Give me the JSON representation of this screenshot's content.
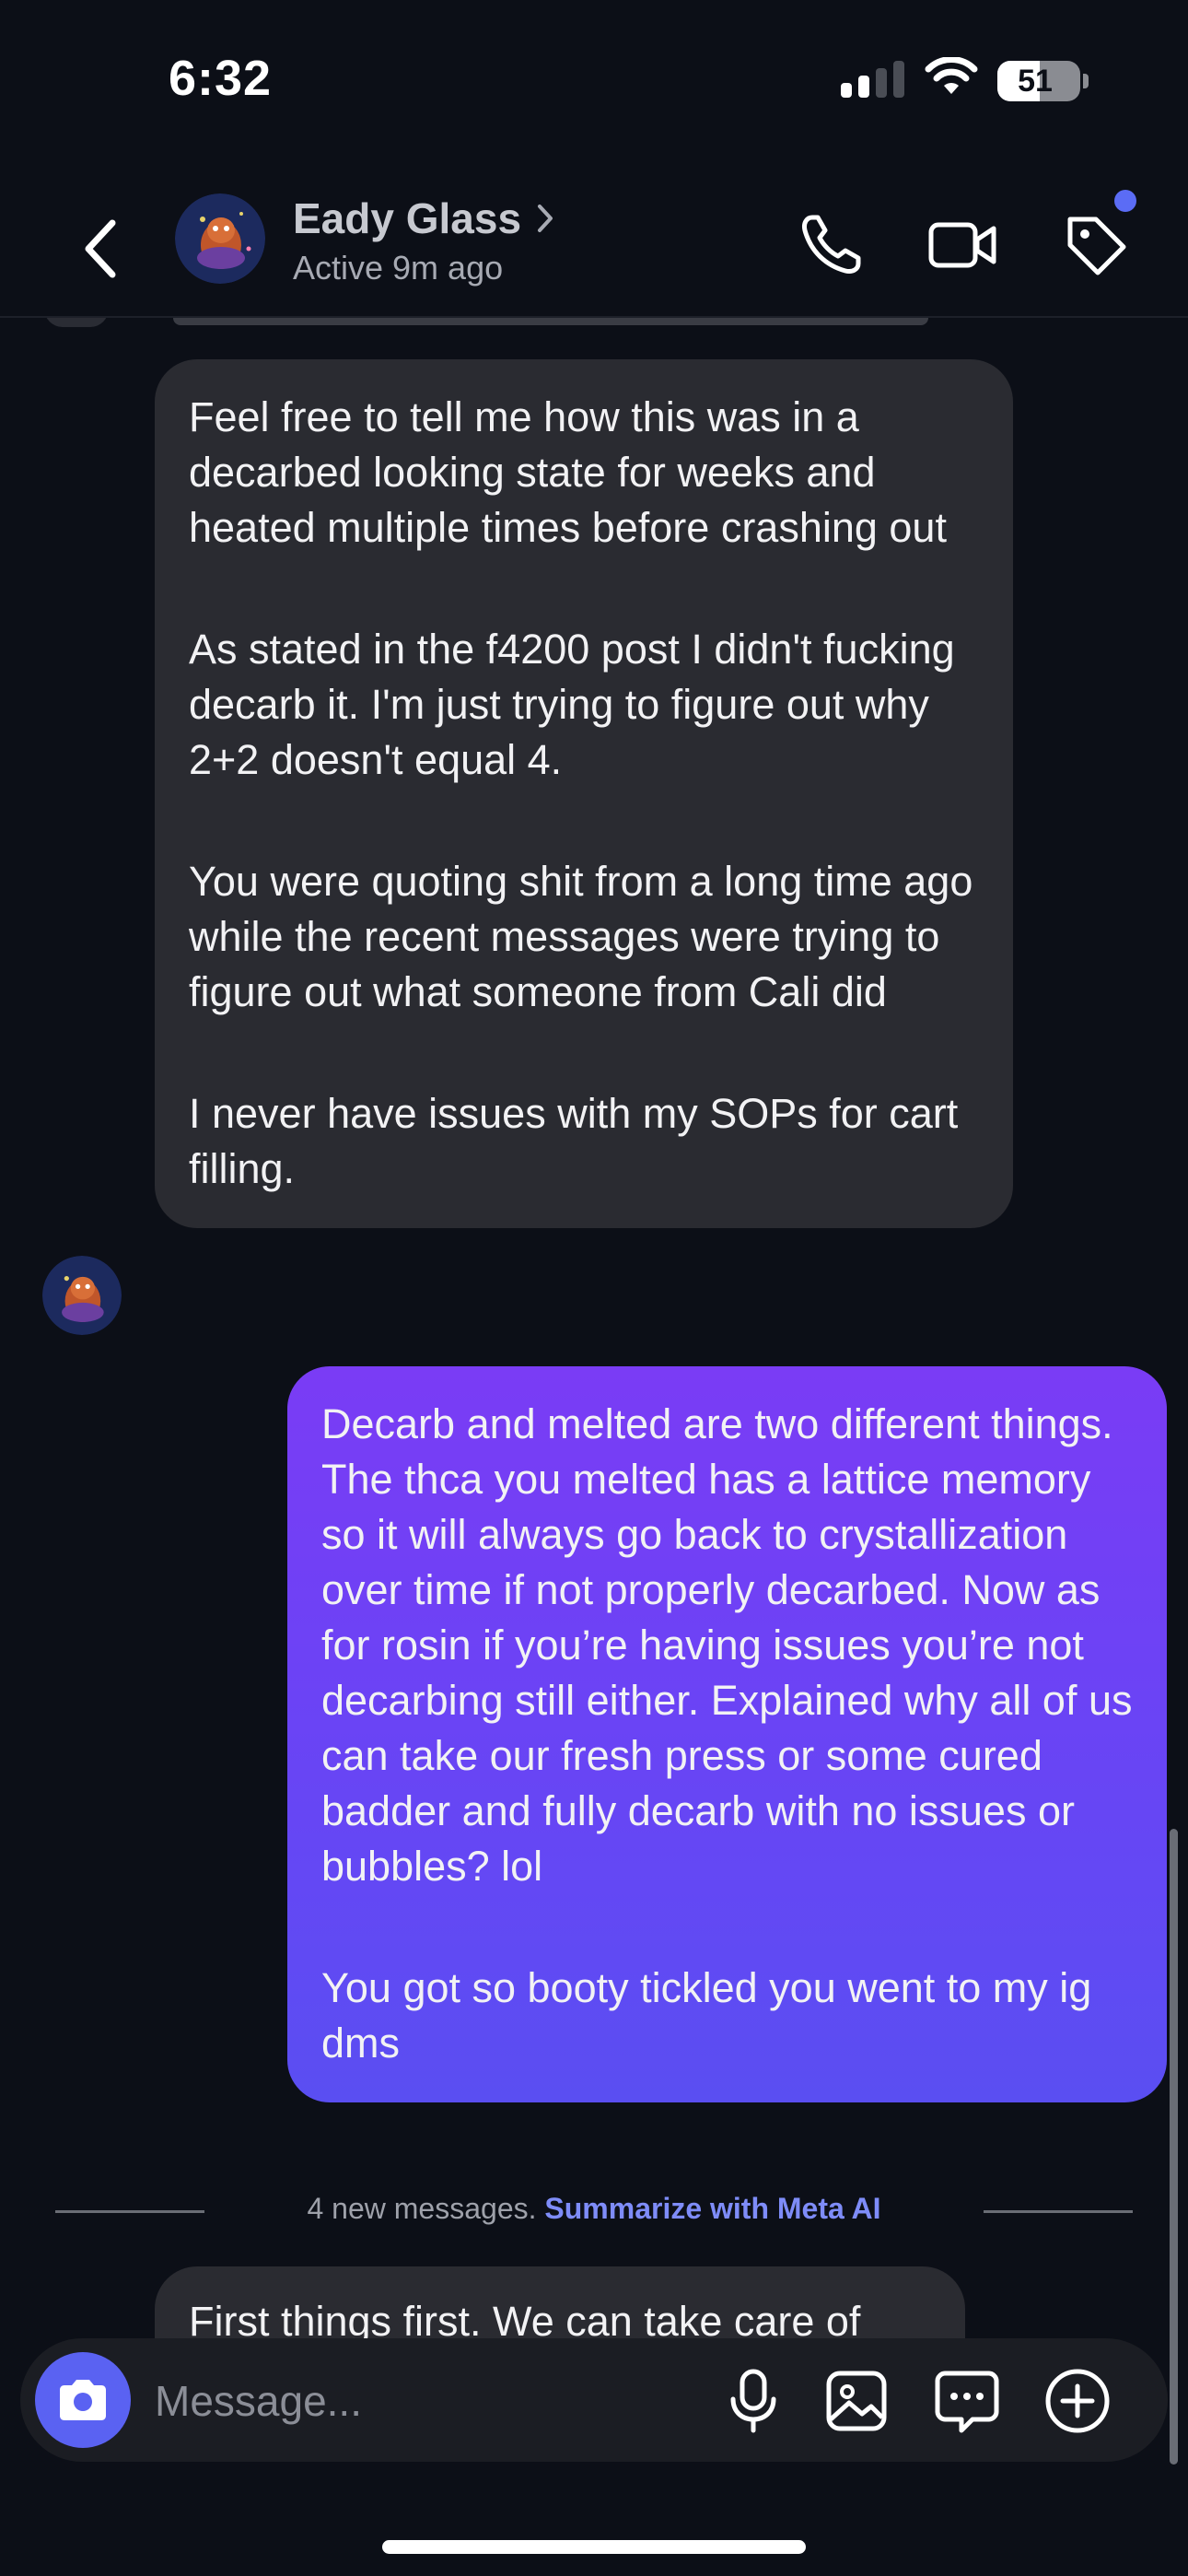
{
  "status_bar": {
    "time": "6:32",
    "battery": "51",
    "icons": [
      "signal-icon",
      "wifi-icon",
      "battery-icon"
    ]
  },
  "header": {
    "contact_name": "Eady Glass",
    "status": "Active 9m ago",
    "icons": [
      "back-chevron-icon",
      "chevron-right-icon",
      "phone-icon",
      "video-camera-icon",
      "tag-icon"
    ],
    "notification_color": "#5b6cf5"
  },
  "messages": {
    "incoming": [
      "Feel free to tell me how this was in a decarbed looking state for weeks and heated multiple times before crashing out",
      "As stated in the f4200 post I didn't fucking decarb it. I'm just trying to figure out why 2+2 doesn't equal 4.",
      "You were quoting shit from a long time ago while the recent messages were trying to figure out what someone from Cali did",
      "I never have issues with my SOPs for cart filling."
    ],
    "outgoing": [
      "Decarb and melted are two different things. The thca you melted has a lattice memory so it will always go back to crystallization over time if not properly decarbed. Now as for rosin if you’re having issues you’re not decarbing still either. Explained why all of us can take our fresh press or some cured badder and fully decarb with no issues or bubbles? lol",
      "You got so booty tickled you went to my ig dms"
    ],
    "divider_text": "4 new messages.",
    "divider_link": "Summarize with Meta AI",
    "peek": "First things first. We can take care of"
  },
  "composer": {
    "placeholder": "Message...",
    "icons": [
      "camera-icon",
      "microphone-icon",
      "image-icon",
      "sticker-icon",
      "plus-icon"
    ]
  },
  "colors": {
    "background": "#0c0f17",
    "incoming_bubble": "#2a2b31",
    "outgoing_bubble_top": "#7a3cf5",
    "outgoing_bubble_bottom": "#5a4ef2",
    "accent": "#5a62f2",
    "link": "#7e8cf8"
  }
}
